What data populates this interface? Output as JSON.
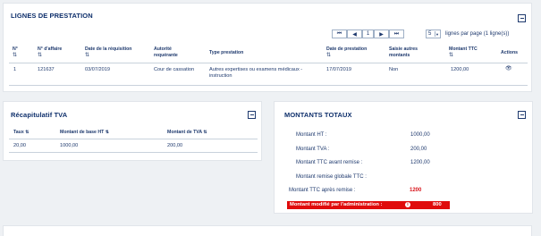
{
  "prestations": {
    "title": "LIGNES DE PRESTATION",
    "pager": {
      "first_icon": "⏮",
      "prev_icon": "◀",
      "page": "1",
      "next_icon": "▶",
      "last_icon": "⏭",
      "per_page": "5",
      "per_page_label": "lignes par page (1 ligne(s))"
    },
    "columns": [
      {
        "label": "N°"
      },
      {
        "label": "N° d'affaire"
      },
      {
        "label": "Date de la réquisition"
      },
      {
        "label": "Autorité requérante"
      },
      {
        "label": "Type prestation"
      },
      {
        "label": "Date de prestation"
      },
      {
        "label": "Saisie autres montants"
      },
      {
        "label": "Montant TTC"
      },
      {
        "label": "Actions"
      }
    ],
    "sort_icon": "⇅",
    "rows": [
      {
        "num": "1",
        "affaire": "121637",
        "date_req": "03/07/2019",
        "autorite": "Cour de cassation",
        "type": "Autres expertises ou examens médicaux - instruction",
        "date_prest": "17/07/2019",
        "saisie": "Non",
        "montant": "1200,00",
        "action_icon": "👁"
      }
    ]
  },
  "tva": {
    "title": "Récapitulatif TVA",
    "columns": [
      {
        "label": "Taux"
      },
      {
        "label": "Montant de base HT"
      },
      {
        "label": "Montant de TVA"
      }
    ],
    "rows": [
      {
        "taux": "20,00",
        "base": "1000,00",
        "tva": "200,00"
      }
    ]
  },
  "totaux": {
    "title": "MONTANTS TOTAUX",
    "lines": [
      {
        "label": "Montant HT :",
        "value": "1000,00"
      },
      {
        "label": "Montant TVA :",
        "value": "200,00"
      },
      {
        "label": "Montant TTC avant remise :",
        "value": "1200,00"
      },
      {
        "label": "Montant remise globale TTC :",
        "value": ""
      }
    ],
    "apres_remise": {
      "label": "Montant TTC après remise :",
      "value": "1200"
    },
    "modifie": {
      "label": "Montant modifié par l'administration :",
      "info_icon": "i",
      "value": "800"
    }
  }
}
